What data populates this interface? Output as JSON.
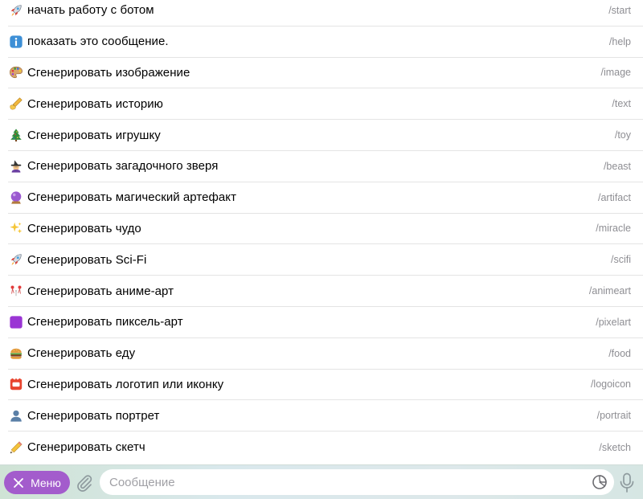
{
  "commands": [
    {
      "icon": "rocket-icon",
      "label": "начать работу с ботом",
      "command": "/start"
    },
    {
      "icon": "info-icon",
      "label": "показать это сообщение.",
      "command": "/help"
    },
    {
      "icon": "palette-icon",
      "label": "Сгенерировать изображение",
      "command": "/image"
    },
    {
      "icon": "writing-hand-icon",
      "label": "Сгенерировать историю",
      "command": "/text"
    },
    {
      "icon": "christmas-tree-icon",
      "label": "Сгенерировать игрушку",
      "command": "/toy"
    },
    {
      "icon": "witch-icon",
      "label": "Сгенерировать загадочного зверя",
      "command": "/beast"
    },
    {
      "icon": "crystal-ball-icon",
      "label": "Сгенерировать магический артефакт",
      "command": "/artifact"
    },
    {
      "icon": "sparkles-icon",
      "label": "Сгенерировать чудо",
      "command": "/miracle"
    },
    {
      "icon": "rocket-icon",
      "label": "Сгенерировать Sci-Fi",
      "command": "/scifi"
    },
    {
      "icon": "wind-chime-icon",
      "label": "Сгенерировать аниме-арт",
      "command": "/animeart"
    },
    {
      "icon": "purple-square-icon",
      "label": "Сгенерировать пиксель-арт",
      "command": "/pixelart"
    },
    {
      "icon": "burger-icon",
      "label": "Сгенерировать еду",
      "command": "/food"
    },
    {
      "icon": "name-badge-icon",
      "label": "Сгенерировать логотип или иконку",
      "command": "/logoicon"
    },
    {
      "icon": "bust-silhouette-icon",
      "label": "Сгенерировать портрет",
      "command": "/portrait"
    },
    {
      "icon": "pencil-icon",
      "label": "Сгенерировать скетч",
      "command": "/sketch"
    }
  ],
  "composer": {
    "menu_label": "Меню",
    "menu_icon": "close-icon",
    "attach_icon": "paperclip-icon",
    "placeholder": "Сообщение",
    "sticker_icon": "sticker-icon",
    "mic_icon": "microphone-icon"
  },
  "colors": {
    "menu_button": "#a35ccc",
    "command_text": "#8e8e93",
    "separator": "#e4e4e4"
  }
}
